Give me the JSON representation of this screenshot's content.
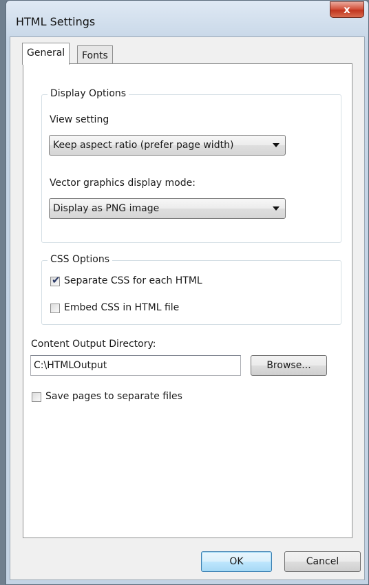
{
  "window": {
    "title": "HTML Settings",
    "close_label": "x"
  },
  "tabs": [
    {
      "label": "General"
    },
    {
      "label": "Fonts"
    }
  ],
  "display_options": {
    "legend": "Display Options",
    "view_setting_label": "View setting",
    "view_setting_value": "Keep aspect ratio (prefer page width)",
    "vector_label": "Vector graphics display mode:",
    "vector_value": "Display as PNG image"
  },
  "css_options": {
    "legend": "CSS Options",
    "separate_css_label": "Separate CSS for each HTML",
    "separate_css_checked": true,
    "embed_css_label": "Embed CSS in HTML file",
    "embed_css_checked": false
  },
  "output": {
    "directory_label": "Content Output Directory:",
    "directory_value": "C:\\HTMLOutput",
    "browse_label": "Browse...",
    "save_separate_label": "Save pages to separate files",
    "save_separate_checked": false
  },
  "buttons": {
    "ok": "OK",
    "cancel": "Cancel"
  }
}
